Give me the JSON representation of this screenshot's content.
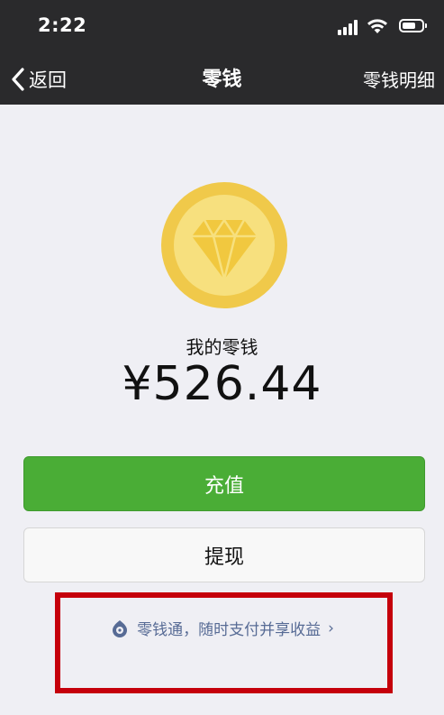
{
  "status_bar": {
    "time": "2:22"
  },
  "nav": {
    "back_label": "返回",
    "title": "零钱",
    "detail_label": "零钱明细"
  },
  "wallet": {
    "balance_label": "我的零钱",
    "balance_amount": "¥526.44"
  },
  "actions": {
    "recharge_label": "充值",
    "withdraw_label": "提现"
  },
  "promo": {
    "text": "零钱通，随时支付并享收益",
    "chevron": "›"
  },
  "colors": {
    "header_bg": "#2a2a2c",
    "page_bg": "#efeff4",
    "recharge_green": "#4aad36",
    "link_blue": "#576b95",
    "highlight_red": "#c5000b",
    "coin_gold": "#f0c94a"
  },
  "icons": [
    "signal-icon",
    "wifi-icon",
    "battery-icon",
    "back-chevron-icon",
    "diamond-coin-icon",
    "lingqiantong-icon"
  ]
}
